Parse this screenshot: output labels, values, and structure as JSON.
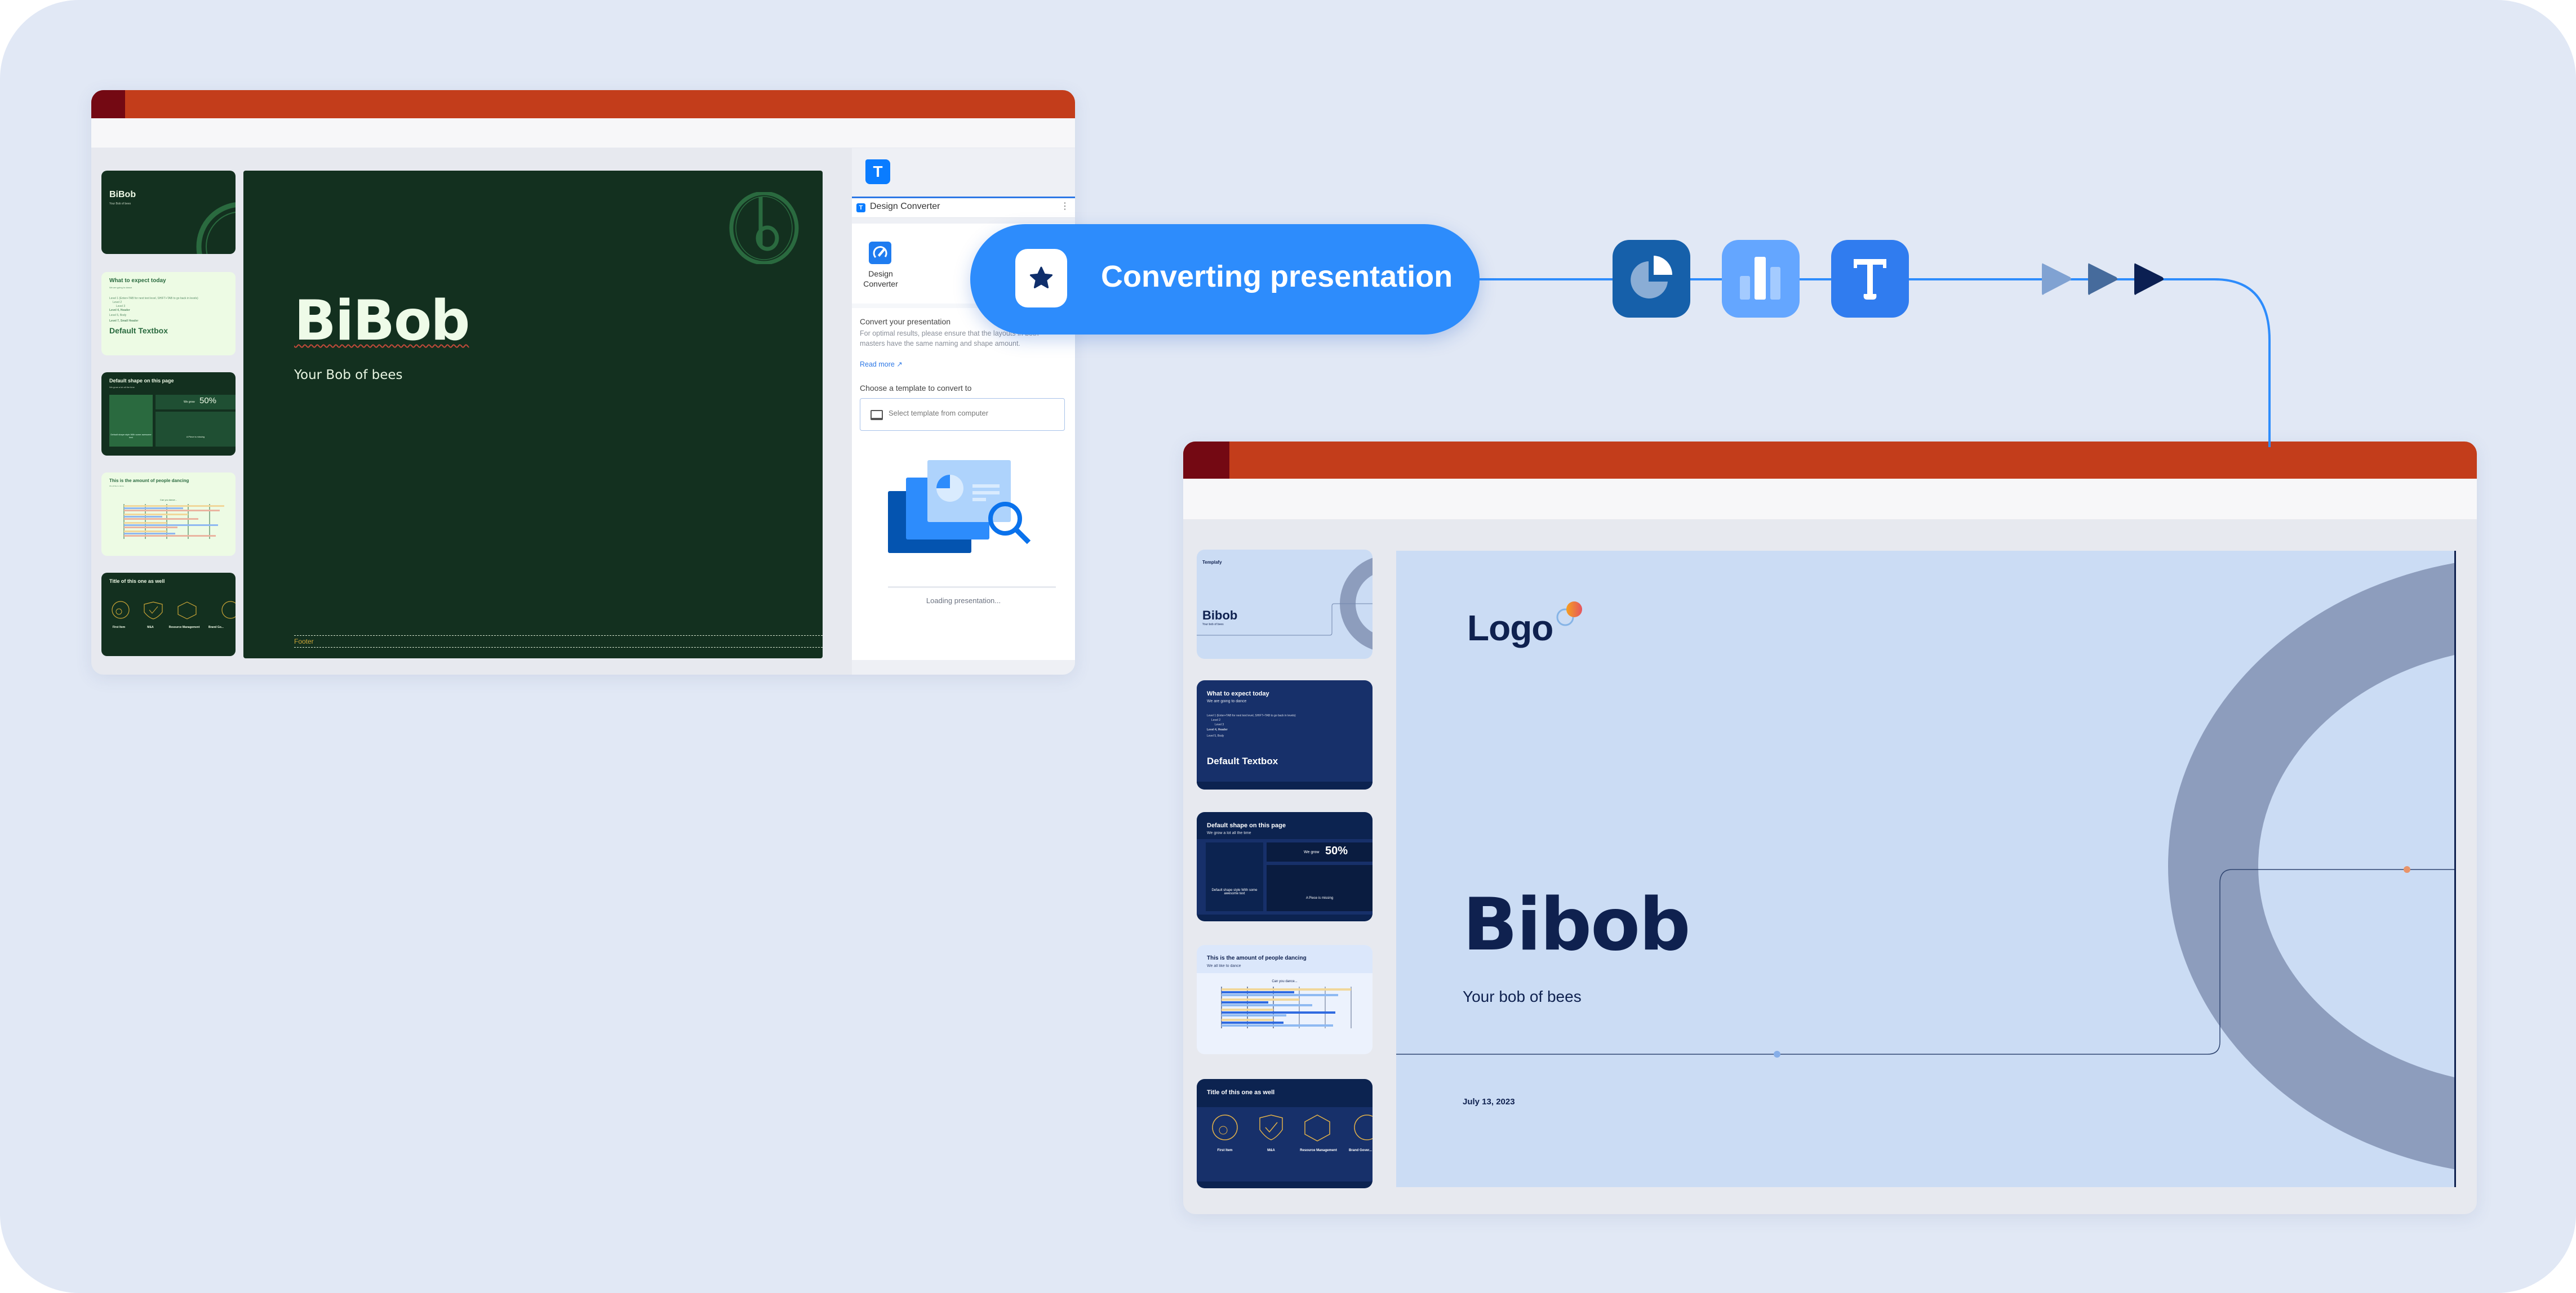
{
  "source_window": {
    "slides": [
      {
        "theme": "dark",
        "title": "BiBob",
        "subtitle": "Your Bob of bees"
      },
      {
        "theme": "light",
        "title": "What to expect today",
        "subtitle": "We are going to dance",
        "lines": [
          "Level 1 (Enter+TAB for next text level, SHIFT+TAB to go back in levels)",
          "Level 2",
          "Level 3",
          "Level 4, Header",
          "Level 5, Body",
          "Level 6",
          "Level 7, Small Header",
          "Level 8, Small Body"
        ],
        "big": "Default Textbox"
      },
      {
        "theme": "dark",
        "title": "Default shape on this page",
        "subtitle": "We grow a lot all the time",
        "stat_prefix": "We grow",
        "stat": "50%",
        "box1": "Default shape style With some awesome text",
        "box2": "A Piece is missing"
      },
      {
        "theme": "light",
        "title": "This is the amount of people dancing",
        "subtitle": "We all like to dance",
        "chart_title": "Can you dance..."
      },
      {
        "theme": "dark",
        "title": "Title of this one as well",
        "items": [
          "First Item",
          "M&A",
          "Resource Management",
          "Brand Go..."
        ]
      }
    ],
    "main_slide": {
      "title": "BiBob",
      "subtitle": "Your Bob of bees",
      "footer": "Footer"
    },
    "taskpane": {
      "app_icon_letter": "T",
      "header_title": "Design Converter",
      "menu_icon": "⋮",
      "hero_label": "Design Converter",
      "section_title": "Convert your presentation",
      "section_text": "For optimal results, please ensure that the layouts in both masters have the same naming and shape amount.",
      "read_more": "Read more ↗",
      "choose_label": "Choose a template to convert to",
      "select_placeholder": "Select template from computer",
      "loading_text": "Loading presentation...",
      "loading_progress": 0
    }
  },
  "converting": {
    "label": "Converting presentation",
    "icon": "star-icon",
    "steps": [
      {
        "icon": "pie-chart-icon",
        "color": "#1660aa"
      },
      {
        "icon": "bar-chart-icon",
        "color": "#64a6ff"
      },
      {
        "icon": "text-icon",
        "color": "#307cef"
      }
    ],
    "arrow_colors": [
      "#80a2d2",
      "#466b9c",
      "#0b1f52"
    ]
  },
  "target_window": {
    "slides": [
      {
        "theme": "light",
        "brand": "Templafy",
        "title": "Bibob",
        "subtitle": "Your bob of bees"
      },
      {
        "theme": "dark",
        "title": "What to expect today",
        "subtitle": "We are going to dance",
        "big": "Default Textbox"
      },
      {
        "theme": "darker",
        "title": "Default shape on this page",
        "subtitle": "We grow a lot all the time",
        "stat_prefix": "We grow",
        "stat": "50%",
        "box1": "Default shape style With some awesome text",
        "box2": "A Piece is missing"
      },
      {
        "theme": "light",
        "title": "This is the amount of people dancing",
        "subtitle": "We all like to dance",
        "chart_title": "Can you dance..."
      },
      {
        "theme": "darker",
        "title": "Title of this one as well",
        "items": [
          "First Item",
          "M&A",
          "Resource Management",
          "Brand Gover..."
        ]
      }
    ],
    "main_slide": {
      "logo": "Logo",
      "title": "Bibob",
      "subtitle": "Your bob of bees",
      "date": "July 13, 2023"
    }
  },
  "colors": {
    "titlebar": "#c33d1b",
    "titlebar_accent": "#740913",
    "source_slide_bg": "#13301f",
    "target_slide_bg": "#cbdcf4",
    "accent_blue": "#2d8cfc",
    "navy": "#0f214f"
  }
}
